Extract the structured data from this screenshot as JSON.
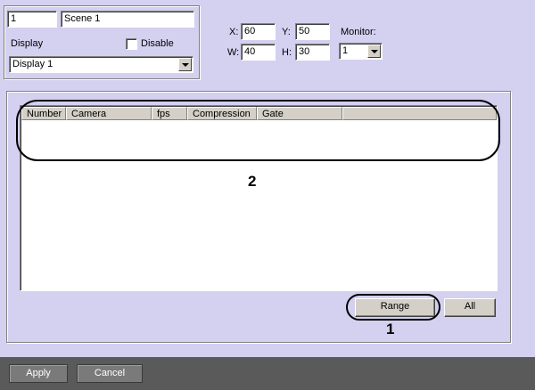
{
  "scene": {
    "id_value": "1",
    "name_value": "Scene 1",
    "display_label": "Display",
    "disable_label": "Disable",
    "disable_checked": false,
    "display_value": "Display 1"
  },
  "geometry_fields": {
    "x_label": "X:",
    "x_value": "60",
    "y_label": "Y:",
    "y_value": "50",
    "w_label": "W:",
    "w_value": "40",
    "h_label": "H:",
    "h_value": "30",
    "monitor_label": "Monitor:",
    "monitor_value": "1"
  },
  "table": {
    "columns": [
      "Number",
      "Camera",
      "fps",
      "Compression",
      "Gate"
    ],
    "rows": []
  },
  "buttons": {
    "range": "Range",
    "all": "All",
    "apply": "Apply",
    "cancel": "Cancel"
  },
  "annotations": {
    "callout_1": "1",
    "callout_2": "2"
  },
  "colors": {
    "background": "#d4d0f0",
    "bottom_bar": "#5a5a5a"
  }
}
